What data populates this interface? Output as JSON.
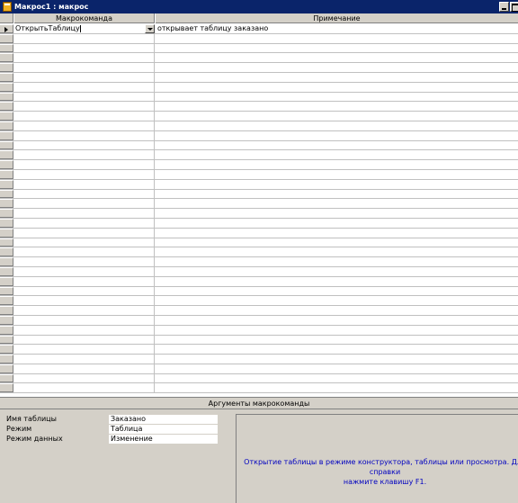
{
  "window": {
    "title": "Макрос1 : макрос"
  },
  "grid": {
    "columns": [
      "Макрокоманда",
      "Примечание"
    ],
    "rows": [
      {
        "action": "ОткрытьТаблицу",
        "note": "открывает таблицу заказано",
        "current": true
      }
    ],
    "empty_row_count": 37
  },
  "arguments": {
    "header": "Аргументы макрокоманды",
    "fields": [
      {
        "label": "Имя таблицы",
        "value": "Заказано"
      },
      {
        "label": "Режим",
        "value": "Таблица"
      },
      {
        "label": "Режим данных",
        "value": "Изменение"
      }
    ],
    "help_line1": "Открытие таблицы в режиме конструктора, таблицы или просмотра. Для справки",
    "help_line2": "нажмите клавишу F1."
  },
  "colors": {
    "titlebar": "#0a246a",
    "face": "#d4d0c8",
    "help_text": "#0000c0"
  }
}
